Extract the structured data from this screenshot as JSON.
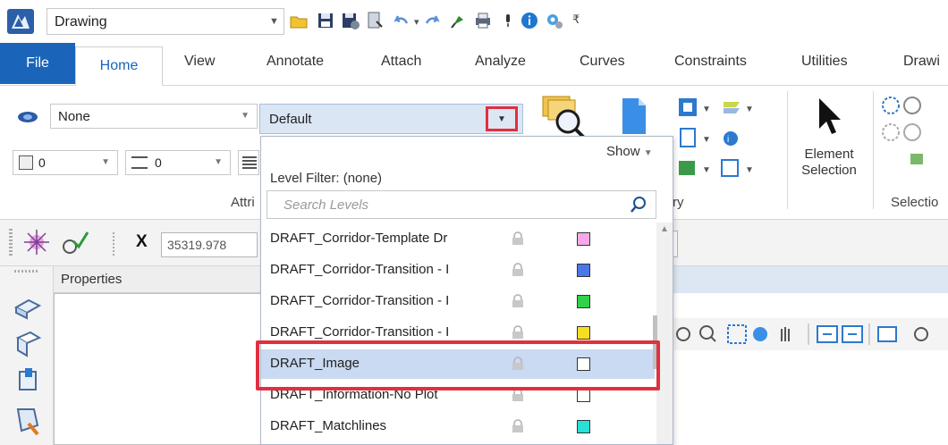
{
  "qat": {
    "file_name": "Drawing",
    "icons": [
      "microstation-logo-icon",
      "open-folder-icon",
      "save-icon",
      "save-settings-icon",
      "compress-icon",
      "undo-icon",
      "redo-icon",
      "pin-icon",
      "print-icon",
      "microphone-icon",
      "info-icon",
      "settings-gear-icon",
      "customize-icon"
    ]
  },
  "tabs": [
    "File",
    "Home",
    "View",
    "Annotate",
    "Attach",
    "Analyze",
    "Curves",
    "Constraints",
    "Utilities",
    "Drawi"
  ],
  "ribbon": {
    "display_style_value": "None",
    "default_level_value": "Default",
    "weight_value_1": "0",
    "weight_value_2": "0",
    "group_attributes": "Attri",
    "group_primary_suffix": "ry",
    "element_selection_line1": "Element",
    "element_selection_line2": "Selection",
    "group_selection": "Selectio"
  },
  "toolbar": {
    "x_label": "X",
    "x_value": "35319.978"
  },
  "properties": {
    "title": "Properties"
  },
  "level_popup": {
    "show_label": "Show",
    "filter_label": "Level Filter: (none)",
    "search_placeholder": "Search Levels",
    "levels": [
      {
        "name": "DRAFT_Corridor-Template Dr",
        "color": "#f6a8e8"
      },
      {
        "name": "DRAFT_Corridor-Transition - I",
        "color": "#4a78e8"
      },
      {
        "name": "DRAFT_Corridor-Transition - I",
        "color": "#2fd24a"
      },
      {
        "name": "DRAFT_Corridor-Transition - I",
        "color": "#f4e020"
      },
      {
        "name": "DRAFT_Image",
        "color": "#ffffff"
      },
      {
        "name": "DRAFT_Information-No Plot",
        "color": "#ffffff"
      },
      {
        "name": "DRAFT_Matchlines",
        "color": "#28e0d8"
      }
    ],
    "selected_index": 4
  }
}
